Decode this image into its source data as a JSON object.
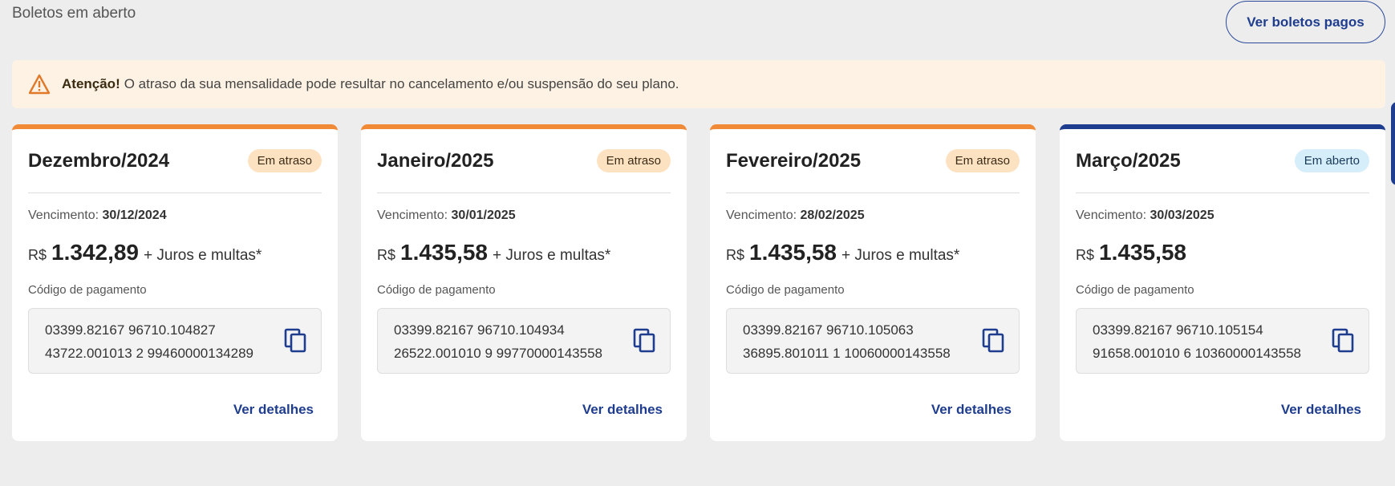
{
  "header": {
    "title": "Boletos em aberto",
    "paid_button": "Ver boletos pagos"
  },
  "alert": {
    "icon": "warning-icon",
    "strong": "Atenção!",
    "text": "O atraso da sua mensalidade pode resultar no cancelamento e/ou suspensão do seu plano."
  },
  "colors": {
    "overdue_accent": "#f08a37",
    "open_accent": "#1f3d8f",
    "link": "#1f3d8f"
  },
  "cards": [
    {
      "month": "Dezembro/2024",
      "status": "Em atraso",
      "due_label": "Vencimento:",
      "due_date": "30/12/2024",
      "currency": "R$",
      "amount": "1.342,89",
      "extra": "+ Juros e multas*",
      "code_label": "Código de pagamento",
      "code_line1": "03399.82167 96710.104827",
      "code_line2": "43722.001013 2 99460000134289",
      "details": "Ver detalhes"
    },
    {
      "month": "Janeiro/2025",
      "status": "Em atraso",
      "due_label": "Vencimento:",
      "due_date": "30/01/2025",
      "currency": "R$",
      "amount": "1.435,58",
      "extra": "+ Juros e multas*",
      "code_label": "Código de pagamento",
      "code_line1": "03399.82167 96710.104934",
      "code_line2": "26522.001010 9 99770000143558",
      "details": "Ver detalhes"
    },
    {
      "month": "Fevereiro/2025",
      "status": "Em atraso",
      "due_label": "Vencimento:",
      "due_date": "28/02/2025",
      "currency": "R$",
      "amount": "1.435,58",
      "extra": "+ Juros e multas*",
      "code_label": "Código de pagamento",
      "code_line1": "03399.82167 96710.105063",
      "code_line2": "36895.801011 1 10060000143558",
      "details": "Ver detalhes"
    },
    {
      "month": "Março/2025",
      "status": "Em aberto",
      "due_label": "Vencimento:",
      "due_date": "30/03/2025",
      "currency": "R$",
      "amount": "1.435,58",
      "extra": "",
      "code_label": "Código de pagamento",
      "code_line1": "03399.82167 96710.105154",
      "code_line2": "91658.001010 6 10360000143558",
      "details": "Ver detalhes"
    }
  ]
}
